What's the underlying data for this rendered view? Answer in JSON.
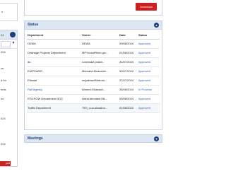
{
  "left": {
    "top_text": "s",
    "count_text": "24",
    "filter_icon": "filter-icon",
    "rows": [
      {
        "text": "024",
        "blue": false
      },
      {
        "text": "ce",
        "blue": false
      },
      {
        "text": "d for",
        "blue": false
      },
      {
        "text": "ents",
        "blue": false
      },
      {
        "text": "ed",
        "blue": true
      },
      {
        "text": "024",
        "blue": false
      },
      {
        "text": "024",
        "blue": false
      }
    ],
    "red_button": "port"
  },
  "download": {
    "label": "Download"
  },
  "status_panel": {
    "title": "Status",
    "collapse_icon": "chevron-up-icon",
    "columns": {
      "department": "Department",
      "owner": "Owner",
      "date": "Date",
      "status": "Status"
    },
    "rows": [
      {
        "department": "DEWA",
        "owner": "DEWA",
        "date": "09/08/2024",
        "status": "Approved",
        "link": false
      },
      {
        "department": "Drainage Projects Department",
        "owner": "MPYousufRhim.gin...",
        "date": "01/08/2024",
        "status": "Approved",
        "link": false
      },
      {
        "department": "du",
        "owner": "Loshmaiz.prakin...",
        "date": "31/07/2024",
        "status": "Approved",
        "link": false
      },
      {
        "department": "EMPOWER",
        "owner": "Mumaira.Muazzam...",
        "date": "30/07/2024",
        "status": "Approved",
        "link": false
      },
      {
        "department": "Etisalat",
        "owner": "mujakhanfMntrula...",
        "date": "27/07/2024",
        "status": "Approved",
        "link": false
      },
      {
        "department": "Rail Agency",
        "owner": "Ahmed.Ghassah...",
        "date": "26/08/2024",
        "status": "In Process",
        "link": true
      },
      {
        "department": "RTA ROW Department NOC",
        "owner": "Aisha.almutairi.Mk...",
        "date": "05/08/2024",
        "status": "Approved",
        "link": false
      },
      {
        "department": "Traffic Department",
        "owner": "TES_Lua.alosaina...",
        "date": "01/08/2024",
        "status": "Approved",
        "link": false
      }
    ]
  },
  "meetings_panel": {
    "title": "Meetings",
    "expand_icon": "chevron-down-icon"
  }
}
